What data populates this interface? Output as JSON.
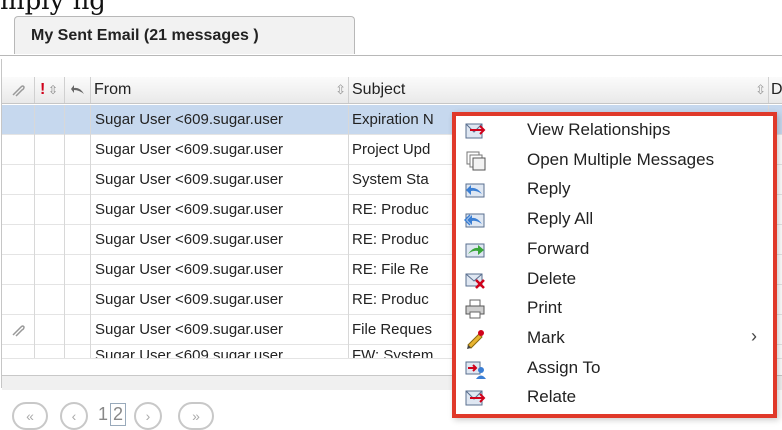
{
  "tab": {
    "label": "My Sent Email (21 messages )"
  },
  "columns": {
    "from": "From",
    "subject": "Subject",
    "d_col": "D"
  },
  "rows": [
    {
      "from": "Sugar User <609.sugar.user",
      "subject": "Expiration N",
      "selected": true
    },
    {
      "from": "Sugar User <609.sugar.user",
      "subject": "Project Upd"
    },
    {
      "from": "Sugar User <609.sugar.user",
      "subject": "System Sta"
    },
    {
      "from": "Sugar User <609.sugar.user",
      "subject": "RE: Produc"
    },
    {
      "from": "Sugar User <609.sugar.user",
      "subject": "RE: Produc"
    },
    {
      "from": "Sugar User <609.sugar.user",
      "subject": "RE: File Re"
    },
    {
      "from": "Sugar User <609.sugar.user",
      "subject": "RE: Produc"
    },
    {
      "from": "Sugar User <609.sugar.user",
      "subject": "File Reques",
      "attachment": true
    },
    {
      "from": "Sugar User <609.sugar.user",
      "subject": "FW: System"
    }
  ],
  "context_menu": {
    "items": [
      {
        "label": "View Relationships",
        "icon": "view-relationships-icon"
      },
      {
        "label": "Open Multiple Messages",
        "icon": "open-multiple-icon"
      },
      {
        "label": "Reply",
        "icon": "reply-icon"
      },
      {
        "label": "Reply All",
        "icon": "reply-all-icon"
      },
      {
        "label": "Forward",
        "icon": "forward-icon"
      },
      {
        "label": "Delete",
        "icon": "delete-icon"
      },
      {
        "label": "Print",
        "icon": "print-icon"
      },
      {
        "label": "Mark",
        "icon": "mark-icon",
        "submenu": true
      },
      {
        "label": "Assign To",
        "icon": "assign-icon"
      },
      {
        "label": "Relate",
        "icon": "relate-icon"
      }
    ],
    "submenu_arrow": "›"
  },
  "pager": {
    "page_text": "1",
    "page_box": "2"
  },
  "colors": {
    "menu_border": "#e0392a",
    "selected_row": "#c6d8ee"
  }
}
